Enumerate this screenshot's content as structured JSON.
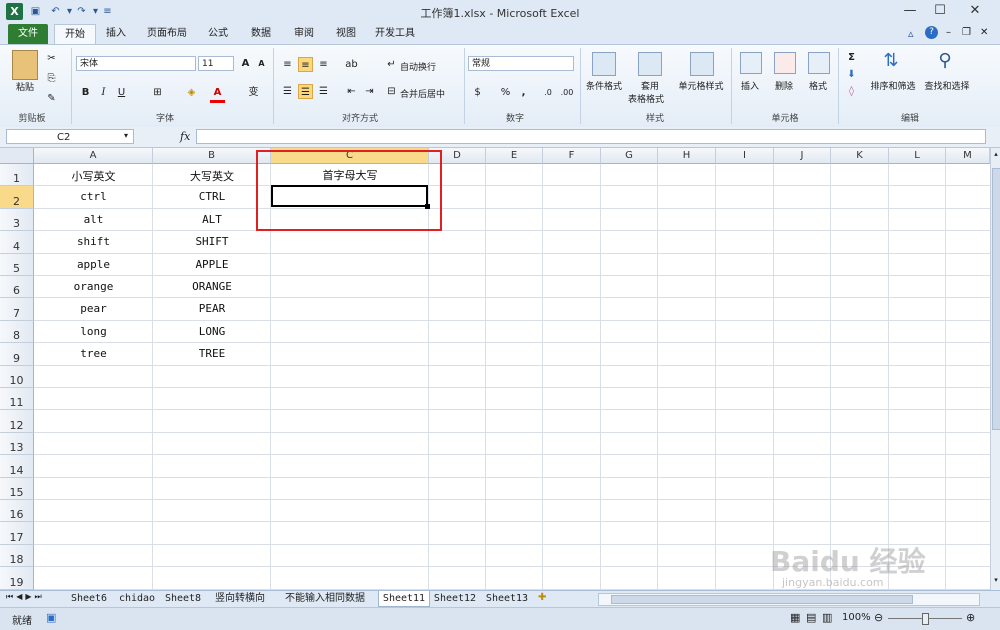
{
  "window": {
    "title": "工作簿1.xlsx - Microsoft Excel"
  },
  "tabs": {
    "file": "文件",
    "items": [
      "开始",
      "插入",
      "页面布局",
      "公式",
      "数据",
      "审阅",
      "视图",
      "开发工具"
    ]
  },
  "ribbon": {
    "clipboard": {
      "paste": "粘贴",
      "label": "剪贴板"
    },
    "font": {
      "name": "宋体",
      "size": "11",
      "bold": "B",
      "italic": "I",
      "underline": "U",
      "grow": "A",
      "shrink": "A",
      "color_glyph": "A",
      "phonetic": "变",
      "label": "字体"
    },
    "alignment": {
      "wrap": "自动换行",
      "merge": "合并后居中",
      "label": "对齐方式"
    },
    "number": {
      "format": "常规",
      "percent": "%",
      "comma": ",",
      "inc": ".0",
      "dec": ".00",
      "label": "数字"
    },
    "styles": {
      "cond": "条件格式",
      "table1": "套用",
      "table2": "表格格式",
      "cell": "单元格样式",
      "label": "样式"
    },
    "cells": {
      "insert": "插入",
      "delete": "删除",
      "format": "格式",
      "label": "单元格"
    },
    "editing": {
      "sigma": "Σ",
      "sort": "排序和筛选",
      "find": "查找和选择",
      "label": "编辑"
    }
  },
  "formula_bar": {
    "name_box": "C2",
    "fx": "fx",
    "value": ""
  },
  "columns": [
    "A",
    "B",
    "C",
    "D",
    "E",
    "F",
    "G",
    "H",
    "I",
    "J",
    "K",
    "L",
    "M"
  ],
  "rows": [
    "1",
    "2",
    "3",
    "4",
    "5",
    "6",
    "7",
    "8",
    "9",
    "10",
    "11",
    "12",
    "13",
    "14",
    "15",
    "16",
    "17",
    "18",
    "19"
  ],
  "cells": {
    "A": [
      "小写英文",
      "ctrl",
      "alt",
      "shift",
      "apple",
      "orange",
      "pear",
      "long",
      "tree"
    ],
    "B": [
      "大写英文",
      "CTRL",
      "ALT",
      "SHIFT",
      "APPLE",
      "ORANGE",
      "PEAR",
      "LONG",
      "TREE"
    ],
    "C1": "首字母大写"
  },
  "active_cell": "C2",
  "sheet_tabs": [
    "Sheet6",
    "chidao",
    "Sheet8",
    "竖向转横向",
    "不能输入相同数据",
    "Sheet11",
    "Sheet12",
    "Sheet13"
  ],
  "active_sheet": "Sheet11",
  "status": {
    "ready": "就绪",
    "zoom": "100%"
  },
  "watermark": {
    "brand": "Baidu 经验",
    "url": "jingyan.baidu.com"
  },
  "colors": {
    "file_tab": "#2f7d32",
    "highlight_box": "#e02020",
    "selected_header": "#f9d98a"
  }
}
